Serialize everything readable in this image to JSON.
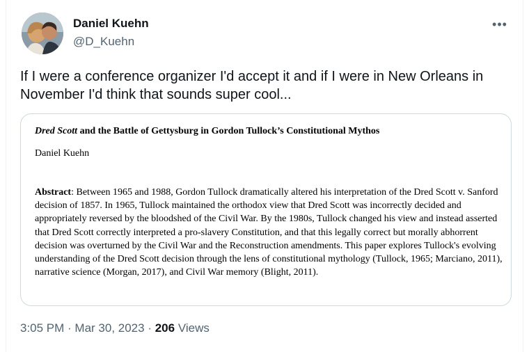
{
  "author": {
    "name": "Daniel Kuehn",
    "handle": "@D_Kuehn"
  },
  "more_icon": "more-horizontal-icon",
  "tweet": {
    "text": "If I were a conference organizer I'd accept it and if I were in New Orleans in November I'd think that sounds super cool..."
  },
  "paper": {
    "title_italic": "Dred Scott",
    "title_rest": " and the Battle of Gettysburg in Gordon Tullock’s Constitutional Mythos",
    "author": "Daniel Kuehn",
    "abstract_label": "Abstract",
    "abstract_text": ": Between 1965 and 1988, Gordon Tullock dramatically altered his interpretation of the Dred Scott v. Sanford decision of 1857. In 1965, Tullock maintained the orthodox view that Dred Scott was incorrectly decided and appropriately reversed by the bloodshed of the Civil War. By the 1980s, Tullock changed his view and instead asserted that Dred Scott correctly interpreted a pro-slavery Constitution, and that this legally correct but morally abhorrent decision was overturned by the Civil War and the Reconstruction amendments. This paper explores Tullock's evolving understanding of the Dred Scott decision through the lens of constitutional mythology (Tullock, 1965; Marciano, 2011), narrative science (Morgan, 2017), and Civil War memory (Blight, 2011)."
  },
  "meta": {
    "time": "3:05 PM",
    "separator1": " · ",
    "date": "Mar 30, 2023",
    "separator2": " · ",
    "views_count": "206",
    "views_label": " Views"
  },
  "colors": {
    "text": "#0f1419",
    "secondary": "#536471",
    "border": "#cfd9de"
  }
}
